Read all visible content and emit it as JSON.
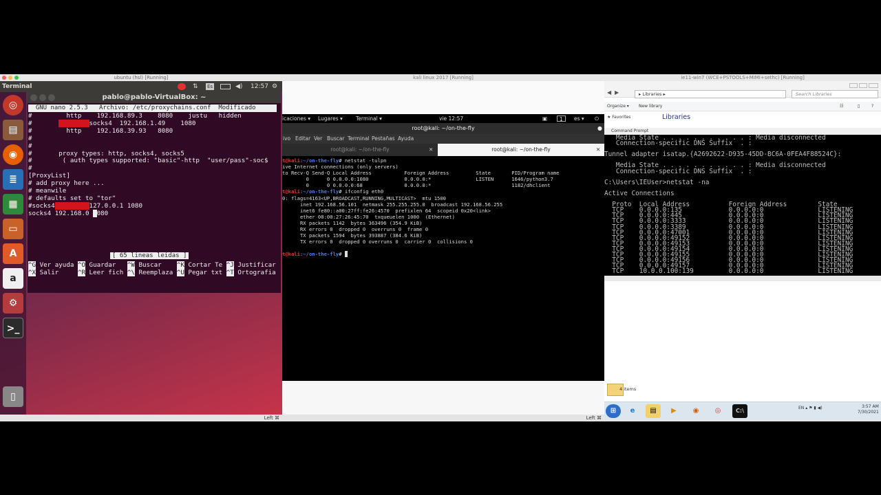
{
  "ubuntu": {
    "vm_title": "ubuntu (hsl) [Running]",
    "app_name": "Terminal",
    "clock": "12:57",
    "kbd": "Es",
    "window_title": "pablo@pablo-VirtualBox: ~",
    "nano_header": "  GNU nano 2.5.3   Archivo: /etc/proxychains.conf  Modificado",
    "nano_lines": [
      "#         http    192.168.89.3    8080    justu   hidden",
      "#        socks4  192.168.1.49    1080",
      "#         http    192.168.39.93   8080",
      "#",
      "#",
      "#       proxy types: http, socks4, socks5",
      "#        ( auth types supported: \"basic\"-http  \"user/pass\"-soc$",
      "#",
      "[ProxyList]",
      "# add proxy here ...",
      "# meanwile",
      "# defaults set to \"tor\"",
      "#socks4         127.0.0.1 1080",
      "socks4 192.168.0 1080"
    ],
    "nano_status": "[ 65 lineas leidas ]",
    "shortcuts_row1": [
      {
        "key": "^G",
        "label": "Ver ayuda"
      },
      {
        "key": "^O",
        "label": "Guardar"
      },
      {
        "key": "^W",
        "label": "Buscar"
      },
      {
        "key": "^K",
        "label": "Cortar Te"
      },
      {
        "key": "^J",
        "label": "Justificar"
      }
    ],
    "shortcuts_row2": [
      {
        "key": "^X",
        "label": "Salir"
      },
      {
        "key": "^R",
        "label": "Leer fich"
      },
      {
        "key": "^\\",
        "label": "Reemplaza"
      },
      {
        "key": "^U",
        "label": "Pegar txt"
      },
      {
        "key": "^T",
        "label": "Ortografia"
      }
    ],
    "host_key": "Left ⌘"
  },
  "kali": {
    "vm_title": "kali linux 2017 [Running]",
    "topbar": {
      "apps": "icaciones ▾",
      "places": "Lugares ▾",
      "terminal": "Terminal ▾",
      "clock": "vie 12:57",
      "workspace": "1",
      "lang": "es ▾"
    },
    "term_title": "root@kali: ~/on-the-fly",
    "menu": [
      "ivo",
      "Editar",
      "Ver",
      "Buscar",
      "Terminal",
      "Pestañas",
      "Ayuda"
    ],
    "tabs": [
      "root@kali: ~/on-the-fly",
      "root@kali: ~/on-the-fly"
    ],
    "prompt": "t@kali",
    "cwd": ":~/on-the-fly",
    "commands": [
      "netstat -tulpn",
      "ifconfig eth0"
    ],
    "netstat_out": [
      "ive Internet connections (only servers)",
      "to Recv-Q Send-Q Local Address           Foreign Address         State       PID/Program name",
      "        0      0 0.0.0.0:1080            0.0.0.0:*               LISTEN      1646/python3.7",
      "        0      0 0.0.0.0:68              0.0.0.0:*                           1182/dhclient"
    ],
    "ifconfig_out": [
      "0: flags=4163<UP,BROADCAST,RUNNING,MULTICAST>  mtu 1500",
      "      inet 192.168.56.101  netmask 255.255.255.0  broadcast 192.168.56.255",
      "      inet6 fe80::a00:27ff:fe26:4570  prefixlen 64  scopeid 0x20<link>",
      "      ether 08:00:27:26:45:70  txqueuelen 1000  (Ethernet)",
      "      RX packets 1142  bytes 363496 (354.9 KiB)",
      "      RX errors 0  dropped 0  overruns 0  frame 0",
      "      TX packets 1594  bytes 393887 (384.6 KiB)",
      "      TX errors 0  dropped 0 overruns 0  carrier 0  collisions 0"
    ],
    "host_key": "Left ⌘"
  },
  "win": {
    "vm_title": "ie11-win7 (WCE+PSTOOLS+MIMI+sethc) [Running]",
    "address": "▸ Libraries ▸",
    "search_placeholder": "Search Libraries",
    "organize": "Organize ▾",
    "new_library": "New library",
    "favorites": "★ Favorites",
    "libraries_title": "Libraries",
    "cmd_title": "Command Prompt",
    "cmd_lines": [
      "   Media State . . . . . . . . . . . : Media disconnected",
      "   Connection-specific DNS Suffix  . :",
      "",
      "Tunnel adapter isatap.{A2692622-D935-45DD-BC6A-0FEA4F88524C}:",
      "",
      "   Media State . . . . . . . . . . . : Media disconnected",
      "   Connection-specific DNS Suffix  . :",
      "",
      "C:\\Users\\IEUser>netstat -na",
      "",
      "Active Connections",
      "",
      "  Proto  Local Address          Foreign Address        State",
      "  TCP    0.0.0.0:135            0.0.0.0:0              LISTENING",
      "  TCP    0.0.0.0:445            0.0.0.0:0              LISTENING",
      "  TCP    0.0.0.0:3333           0.0.0.0:0              LISTENING",
      "  TCP    0.0.0.0:3389           0.0.0.0:0              LISTENING",
      "  TCP    0.0.0.0:47001          0.0.0.0:0              LISTENING",
      "  TCP    0.0.0.0:49152          0.0.0.0:0              LISTENING",
      "  TCP    0.0.0.0:49153          0.0.0.0:0              LISTENING",
      "  TCP    0.0.0.0:49154          0.0.0.0:0              LISTENING",
      "  TCP    0.0.0.0:49155          0.0.0.0:0              LISTENING",
      "  TCP    0.0.0.0:49156          0.0.0.0:0              LISTENING",
      "  TCP    0.0.0.0:49157          0.0.0.0:0              LISTENING",
      "  TCP    10.0.0.100:139         0.0.0.0:0              LISTENING"
    ],
    "items_count": "4 items",
    "lang": "EN",
    "clock_time": "3:57 AM",
    "clock_date": "7/30/2021",
    "host_key": "Left ⌘"
  }
}
